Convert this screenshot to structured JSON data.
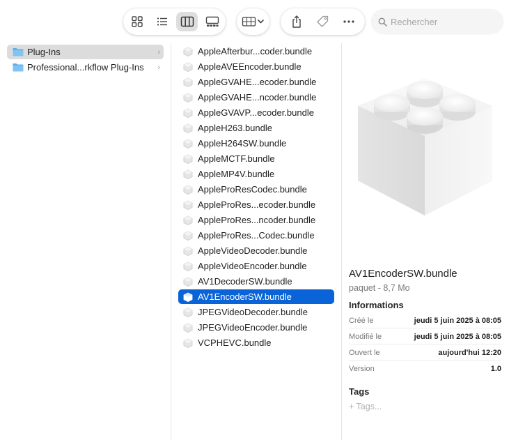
{
  "toolbar": {
    "views": [
      {
        "icon": "icon-view-icon",
        "active": false
      },
      {
        "icon": "list-view-icon",
        "active": false
      },
      {
        "icon": "column-view-icon",
        "active": true
      },
      {
        "icon": "gallery-view-icon",
        "active": false
      }
    ],
    "group_icon": "group-by-icon",
    "actions": [
      {
        "icon": "share-icon"
      },
      {
        "icon": "tag-icon"
      },
      {
        "icon": "more-icon"
      }
    ],
    "search_placeholder": "Rechercher"
  },
  "column1": {
    "items": [
      {
        "label": "Plug-Ins",
        "selected": true
      },
      {
        "label": "Professional...rkflow Plug-Ins",
        "selected": false
      }
    ]
  },
  "column2": {
    "items": [
      {
        "label": "AppleAfterbur...coder.bundle",
        "selected": false
      },
      {
        "label": "AppleAVEEncoder.bundle",
        "selected": false
      },
      {
        "label": "AppleGVAHE...ecoder.bundle",
        "selected": false
      },
      {
        "label": "AppleGVAHE...ncoder.bundle",
        "selected": false
      },
      {
        "label": "AppleGVAVP...ecoder.bundle",
        "selected": false
      },
      {
        "label": "AppleH263.bundle",
        "selected": false
      },
      {
        "label": "AppleH264SW.bundle",
        "selected": false
      },
      {
        "label": "AppleMCTF.bundle",
        "selected": false
      },
      {
        "label": "AppleMP4V.bundle",
        "selected": false
      },
      {
        "label": "AppleProResCodec.bundle",
        "selected": false
      },
      {
        "label": "AppleProRes...ecoder.bundle",
        "selected": false
      },
      {
        "label": "AppleProRes...ncoder.bundle",
        "selected": false
      },
      {
        "label": "AppleProRes...Codec.bundle",
        "selected": false
      },
      {
        "label": "AppleVideoDecoder.bundle",
        "selected": false
      },
      {
        "label": "AppleVideoEncoder.bundle",
        "selected": false
      },
      {
        "label": "AV1DecoderSW.bundle",
        "selected": false
      },
      {
        "label": "AV1EncoderSW.bundle",
        "selected": true
      },
      {
        "label": "JPEGVideoDecoder.bundle",
        "selected": false
      },
      {
        "label": "JPEGVideoEncoder.bundle",
        "selected": false
      },
      {
        "label": "VCPHEVC.bundle",
        "selected": false
      }
    ]
  },
  "preview": {
    "icon": "plugin-bundle-icon",
    "name": "AV1EncoderSW.bundle",
    "kind": "paquet - 8,7 Mo",
    "info_heading": "Informations",
    "info": [
      {
        "key": "Créé le",
        "value": "jeudi 5 juin 2025 à 08:05"
      },
      {
        "key": "Modifié le",
        "value": "jeudi 5 juin 2025 à 08:05"
      },
      {
        "key": "Ouvert le",
        "value": "aujourd'hui 12:20"
      },
      {
        "key": "Version",
        "value": "1.0"
      }
    ],
    "tags_heading": "Tags",
    "tags_placeholder": "+ Tags..."
  },
  "colors": {
    "selection": "#0a64d8",
    "folder": "#5ab0ec"
  }
}
